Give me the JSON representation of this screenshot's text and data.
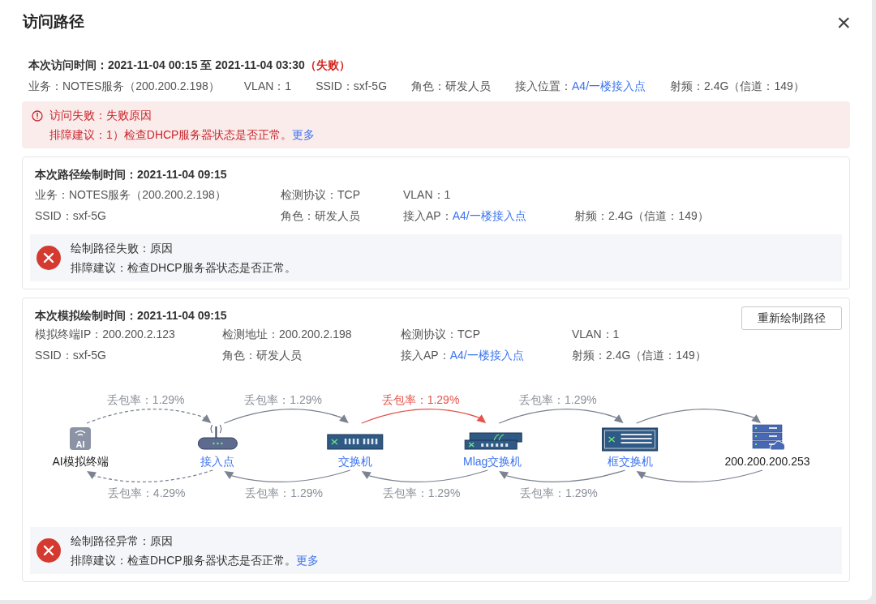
{
  "window": {
    "title": "访问路径",
    "close": "×"
  },
  "visit": {
    "title": "本次访问时间：2021-11-04 00:15 至 2021-11-04 03:30",
    "status": "（失败）",
    "failed": true,
    "fields": [
      {
        "label": "业务：",
        "value": "NOTES服务（200.200.2.198）",
        "link": false
      },
      {
        "label": "VLAN：",
        "value": "1",
        "link": false
      },
      {
        "label": "SSID：",
        "value": "sxf-5G",
        "link": false
      },
      {
        "label": "角色：",
        "value": "研发人员",
        "link": false
      },
      {
        "label": "接入位置：",
        "value": "A4/一楼接入点",
        "link": true
      },
      {
        "label": "射频：",
        "value": "2.4G（信道：149）",
        "link": false
      }
    ],
    "alert": {
      "kind": "warning",
      "title": "访问失败：失败原因",
      "advice": "排障建议：1）检查DHCP服务器状态是否正常。",
      "link": "更多"
    }
  },
  "cards": [
    {
      "title": "本次路径绘制时间：2021-11-04 09:15",
      "rows": [
        [
          {
            "label": "业务：",
            "value": "NOTES服务（200.200.2.198）",
            "link": false
          },
          {
            "label": "检测协议：",
            "value": "TCP",
            "link": false
          },
          {
            "label": "VLAN：",
            "value": "1",
            "link": false
          }
        ],
        [
          {
            "label": "SSID：",
            "value": "sxf-5G",
            "link": false
          },
          {
            "label": "角色：",
            "value": "研发人员",
            "link": false
          },
          {
            "label": "接入AP：",
            "value": "A4/一楼接入点",
            "link": true
          },
          {
            "label": "射频：",
            "value": "2.4G（信道：149）",
            "link": false
          }
        ]
      ],
      "alert": {
        "kind": "error",
        "title": "绘制路径失败：原因",
        "advice": "排障建议：检查DHCP服务器状态是否正常。"
      }
    },
    {
      "title": "本次模拟绘制时间：2021-11-04 09:15",
      "button": "重新绘制路径",
      "rows": [
        [
          {
            "label": "模拟终端IP：",
            "value": "200.200.2.123",
            "link": false
          },
          {
            "label": "检测地址：",
            "value": "200.200.2.198",
            "link": false
          },
          {
            "label": "检测协议：",
            "value": "TCP",
            "link": false
          },
          {
            "label": "VLAN：",
            "value": "1",
            "link": false
          }
        ],
        [
          {
            "label": "SSID：",
            "value": "sxf-5G",
            "link": false
          },
          {
            "label": "角色：",
            "value": "研发人员",
            "link": false
          },
          {
            "label": "接入AP：",
            "value": "A4/一楼接入点",
            "link": true
          },
          {
            "label": "射频：",
            "value": "2.4G（信道：149）",
            "link": false
          }
        ]
      ],
      "diagram": {
        "nodes": [
          {
            "kind": "terminal",
            "label": "AI模拟终端",
            "icon_text": "AI",
            "link": false
          },
          {
            "kind": "ap",
            "label": "接入点",
            "link": true
          },
          {
            "kind": "switch",
            "label": "交换机",
            "link": true
          },
          {
            "kind": "mlag",
            "label": "Mlag交换机",
            "link": true
          },
          {
            "kind": "chassis",
            "label": "框交换机",
            "link": true
          },
          {
            "kind": "server",
            "label": "200.200.200.253",
            "link": false
          }
        ],
        "top_links": [
          {
            "label": "丢包率：1.29%",
            "error": false,
            "dashed": true
          },
          {
            "label": "丢包率：1.29%",
            "error": false,
            "dashed": false
          },
          {
            "label": "丢包率：1.29%",
            "error": true,
            "dashed": false
          },
          {
            "label": "丢包率：1.29%",
            "error": false,
            "dashed": false
          },
          {
            "error": false,
            "dashed": false
          }
        ],
        "bottom_links": [
          {
            "label": "丢包率：4.29%",
            "error": false,
            "dashed": true
          },
          {
            "label": "丢包率：1.29%",
            "error": false,
            "dashed": false
          },
          {
            "label": "丢包率：1.29%",
            "error": false,
            "dashed": false
          },
          {
            "label": "丢包率：1.29%",
            "error": false,
            "dashed": false
          },
          {
            "error": false,
            "dashed": false
          }
        ]
      },
      "alert": {
        "kind": "error",
        "title": "绘制路径异常：原因",
        "advice": "排障建议：检查DHCP服务器状态是否正常。",
        "link": "更多"
      }
    }
  ]
}
